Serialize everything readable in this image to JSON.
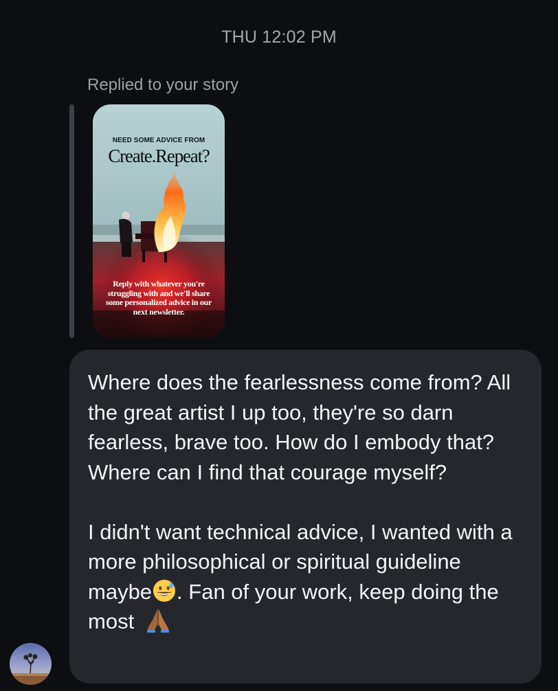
{
  "header": {
    "timestamp": "THU 12:02 PM"
  },
  "story_reply": {
    "label": "Replied to your story",
    "story": {
      "kicker": "NEED SOME ADVICE FROM",
      "brand": "Create.Repeat?",
      "caption": "Reply with whatever you're struggling with and we'll share some personalized advice in our next newsletter."
    }
  },
  "message": {
    "paragraph1": "Where does the fearlessness come from? All the great artist I up too, they're so darn fearless, brave too. How do I embody that? Where can I find that courage myself?",
    "paragraph2_before_emoji": "I didn't want technical advice, I wanted with a more philosophical or spiritual guideline maybe",
    "emoji1": "grinning-face-with-sweat-icon",
    "paragraph2_after_emoji": ". Fan of your work, keep doing the most ",
    "emoji2": "folded-hands-icon"
  },
  "colors": {
    "background": "#0c0e12",
    "bubble": "#25272d",
    "text": "#f3f4f6",
    "muted": "#a3a7ad"
  }
}
